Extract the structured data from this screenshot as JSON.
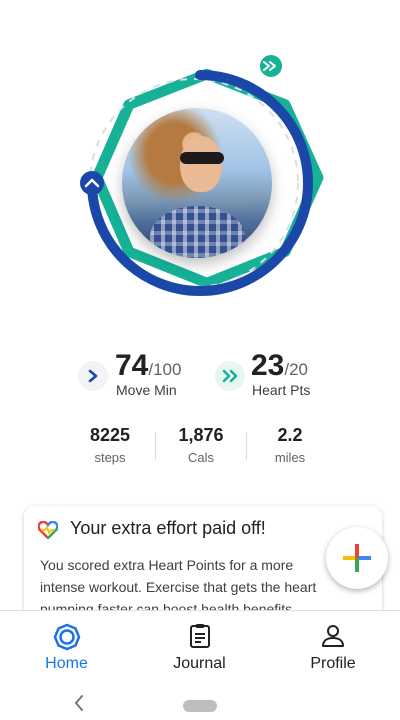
{
  "colors": {
    "heart_green": "#16b197",
    "move_blue": "#1a47a8",
    "accent": "#1a73e8",
    "card_heart_colors": [
      "#4285f4",
      "#ea4335",
      "#fbbc04",
      "#34a853"
    ]
  },
  "goals": {
    "move_min": {
      "value": "74",
      "goal": "/100",
      "label": "Move Min",
      "icon": "chevron-right-icon",
      "progress": 0.74
    },
    "heart_pts": {
      "value": "23",
      "goal": "/20",
      "label": "Heart Pts",
      "icon": "double-chevron-right-icon",
      "progress": 1.15
    }
  },
  "stats": [
    {
      "value": "8225",
      "label": "steps"
    },
    {
      "value": "1,876",
      "label": "Cals"
    },
    {
      "value": "2.2",
      "label": "miles"
    }
  ],
  "card": {
    "icon": "heart-icon",
    "title": "Your extra effort paid off!",
    "body": "You scored extra Heart Points for a more intense workout. Exercise that gets the heart pumping faster can boost health benefits."
  },
  "fab": {
    "icon": "add-icon"
  },
  "nav": [
    {
      "label": "Home",
      "icon": "home-icon",
      "active": true
    },
    {
      "label": "Journal",
      "icon": "journal-icon",
      "active": false
    },
    {
      "label": "Profile",
      "icon": "profile-icon",
      "active": false
    }
  ],
  "system": {
    "back_icon": "back-icon",
    "home_icon": "home-pill"
  }
}
